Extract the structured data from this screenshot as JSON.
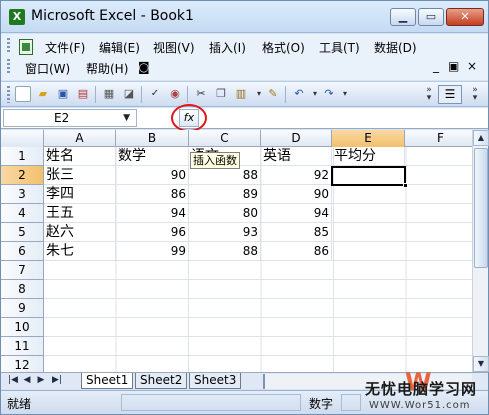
{
  "window": {
    "title": "Microsoft Excel - Book1",
    "app_icon": "X",
    "controls": [
      "minimize-icon",
      "maximize-icon",
      "close-icon"
    ]
  },
  "menu": {
    "row1": [
      "文件(F)",
      "编辑(E)",
      "视图(V)",
      "插入(I)",
      "格式(O)",
      "工具(T)",
      "数据(D)"
    ],
    "row2": [
      "窗口(W)",
      "帮助(H)"
    ],
    "mdi_controls": [
      "_",
      "×"
    ],
    "mdi_restore": "▣"
  },
  "toolbar": {
    "icons": [
      "new-icon",
      "open-icon",
      "save-icon",
      "permission-icon",
      "print-icon",
      "print-preview-icon",
      "spelling-icon",
      "research-icon",
      "cut-icon",
      "copy-icon",
      "paste-icon",
      "format-painter-icon",
      "undo-icon",
      "redo-icon",
      "toolbar-options-icon",
      "align-icon"
    ]
  },
  "formula_bar": {
    "name_box": "E2",
    "fx_label": "fx",
    "formula": ""
  },
  "tooltip": "插入函数",
  "sheet": {
    "columns": [
      "A",
      "B",
      "C",
      "D",
      "E",
      "F"
    ],
    "rows": [
      "1",
      "2",
      "3",
      "4",
      "5",
      "6",
      "7",
      "8",
      "9",
      "10",
      "11",
      "12"
    ],
    "active_cell": "E2",
    "headers": [
      "姓名",
      "数学",
      "语文",
      "英语",
      "平均分"
    ],
    "records": [
      {
        "name": "张三",
        "math": "90",
        "chinese": "88",
        "english": "92"
      },
      {
        "name": "李四",
        "math": "86",
        "chinese": "89",
        "english": "90"
      },
      {
        "name": "王五",
        "math": "94",
        "chinese": "80",
        "english": "94"
      },
      {
        "name": "赵六",
        "math": "96",
        "chinese": "93",
        "english": "85"
      },
      {
        "name": "朱七",
        "math": "99",
        "chinese": "88",
        "english": "86"
      }
    ]
  },
  "tabs": {
    "nav": [
      "|◀",
      "◀",
      "▶",
      "▶|"
    ],
    "sheets": [
      "Sheet1",
      "Sheet2",
      "Sheet3"
    ],
    "active": "Sheet1"
  },
  "status": {
    "ready": "就绪",
    "mode": "数字"
  },
  "watermark": {
    "title": "无忧电脑学习网",
    "url": "WWW.Wor51.com"
  },
  "colors": {
    "highlight_ring": "#e01515",
    "active_header": "#f3c06d",
    "titlebar": "#c5dbf3"
  }
}
